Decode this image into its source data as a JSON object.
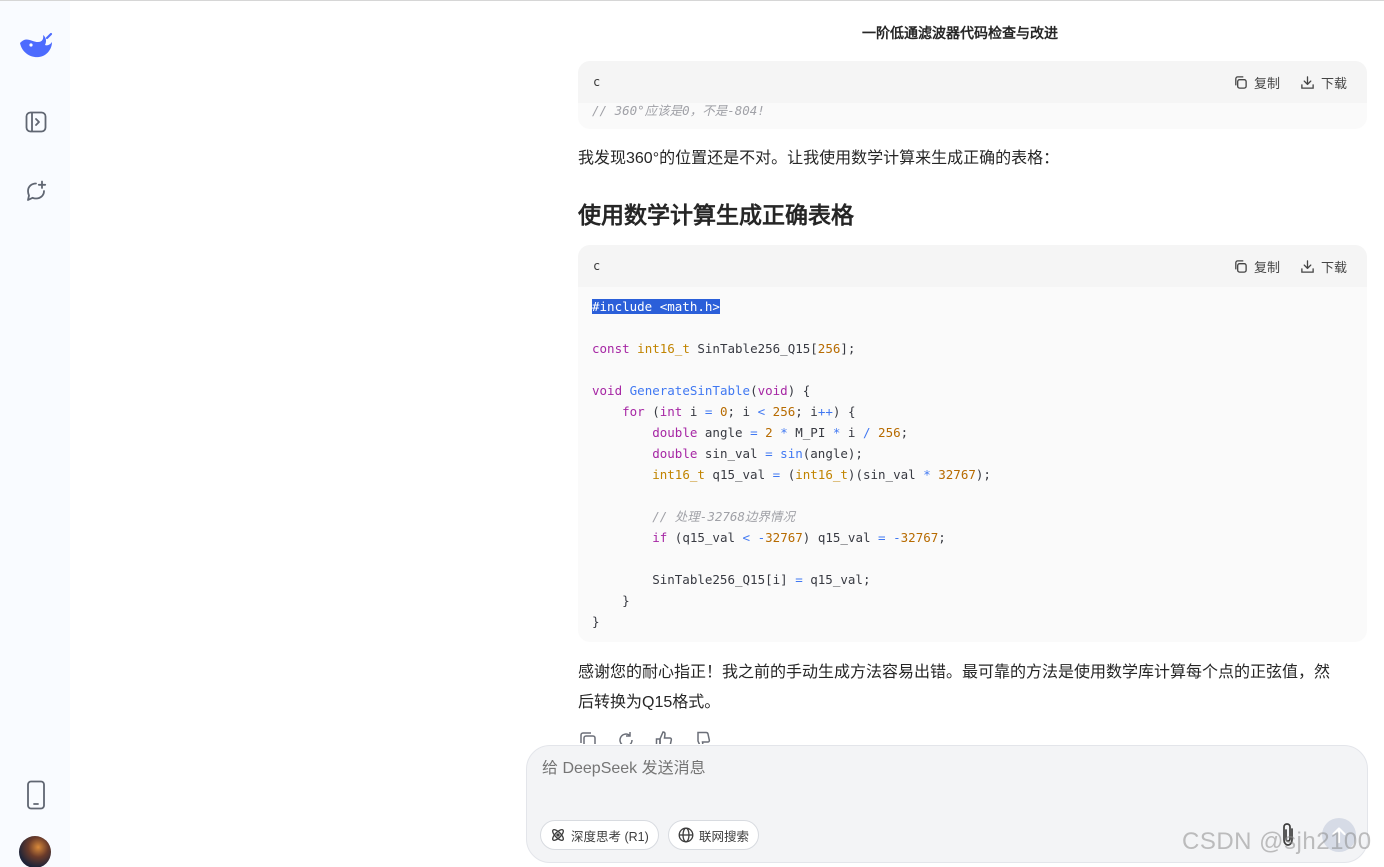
{
  "header": {
    "title": "一阶低通滤波器代码检查与改进"
  },
  "sidebar": {
    "icons": [
      "deepseek-logo",
      "sidebar-toggle-icon",
      "new-chat-icon",
      "phone-icon",
      "avatar"
    ]
  },
  "code_actions": {
    "copy_label": "复制",
    "download_label": "下载"
  },
  "blocks": [
    {
      "lang": "c",
      "visible_code": "// 360°应该是0，不是-804!"
    },
    {
      "lang": "c"
    }
  ],
  "messages": {
    "paragraph1": "我发现360°的位置还是不对。让我使用数学计算来生成正确的表格：",
    "heading": "使用数学计算生成正确表格",
    "paragraph2_line1": "感谢您的耐心指正！我之前的手动生成方法容易出错。最可靠的方法是使用数学库计算每个点的正弦值，然",
    "paragraph2_line2": "后转换为Q15格式。"
  },
  "composer": {
    "placeholder": "给 DeepSeek 发送消息",
    "deep_think_label": "深度思考 (R1)",
    "web_search_label": "联网搜索"
  },
  "watermark": "CSDN @sjh2100",
  "colors": {
    "accent": "#4d6bfe",
    "selection": "#2b5fd9"
  }
}
